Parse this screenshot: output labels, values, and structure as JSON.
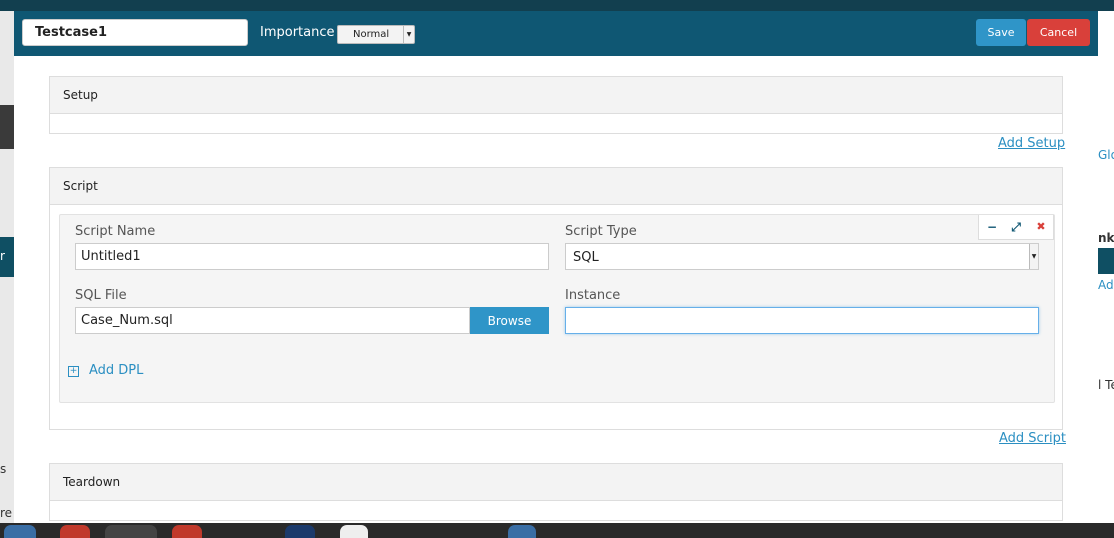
{
  "background": {
    "right_fragments": [
      "Glo",
      "nk",
      "Add",
      "l Te"
    ],
    "left_fragments": [
      "r",
      "s",
      "re"
    ]
  },
  "header": {
    "title_value": "Testcase1",
    "importance_label": "Importance",
    "importance_value": "Normal",
    "save_label": "Save",
    "cancel_label": "Cancel"
  },
  "setup": {
    "title": "Setup",
    "add_label": "Add Setup"
  },
  "script": {
    "title": "Script",
    "add_label": "Add Script",
    "card": {
      "script_name_label": "Script Name",
      "script_name_value": "Untitled1",
      "script_type_label": "Script Type",
      "script_type_value": "SQL",
      "sql_file_label": "SQL File",
      "sql_file_value": "Case_Num.sql",
      "browse_label": "Browse",
      "instance_label": "Instance",
      "instance_value": "",
      "add_dpl_label": "Add DPL",
      "tools": {
        "minimize_glyph": "−",
        "expand_glyph": "⤢",
        "close_glyph": "✖"
      }
    }
  },
  "teardown": {
    "title": "Teardown"
  },
  "colors": {
    "header_bg": "#0f5773",
    "primary": "#2f95c8",
    "danger": "#d9403a",
    "link": "#2b8fc2"
  }
}
